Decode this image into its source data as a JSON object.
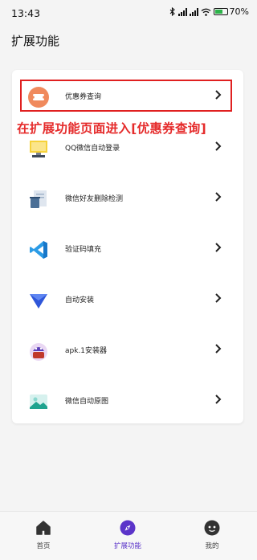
{
  "status_bar": {
    "time": "13:43",
    "battery": "70",
    "battery_unit": "%",
    "battery_level": 0.7
  },
  "page": {
    "title": "扩展功能"
  },
  "annotation": {
    "text": "在扩展功能页面进入[优惠券查询]"
  },
  "rows": [
    {
      "label": "优惠券查询",
      "icon": "coupon-icon"
    },
    {
      "label": "QQ微信自动登录",
      "icon": "computer-icon"
    },
    {
      "label": "微信好友删除检测",
      "icon": "trash-document-icon"
    },
    {
      "label": "验证码填充",
      "icon": "vscode-icon"
    },
    {
      "label": "自动安装",
      "icon": "install-triangle-icon"
    },
    {
      "label": "apk.1安装器",
      "icon": "android-robot-icon"
    },
    {
      "label": "微信自动原图",
      "icon": "image-icon"
    }
  ],
  "tabs": [
    {
      "label": "首页",
      "icon": "home-icon"
    },
    {
      "label": "扩展功能",
      "icon": "compass-icon",
      "active": true
    },
    {
      "label": "我的",
      "icon": "profile-icon"
    }
  ],
  "colors": {
    "accent": "#5b34c9",
    "annotation": "#e52b2b",
    "highlight": "#e02020"
  }
}
